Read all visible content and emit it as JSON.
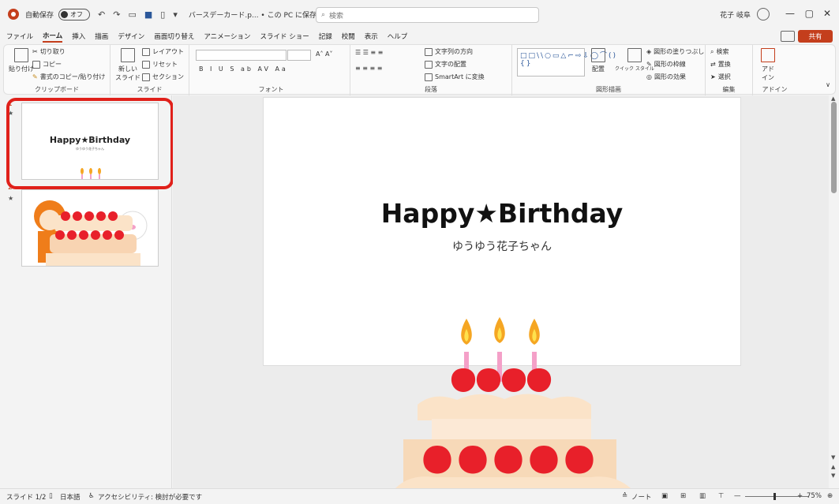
{
  "titlebar": {
    "autosave_label": "自動保存",
    "autosave_state": "オフ",
    "doc_title": "バースデーカード.p... • この PC に保存済み ∨",
    "search_placeholder": "検索",
    "user_name": "花子 岐阜",
    "minimize": "—",
    "restore": "▢",
    "close": "✕"
  },
  "tabs": [
    "ファイル",
    "ホーム",
    "挿入",
    "描画",
    "デザイン",
    "画面切り替え",
    "アニメーション",
    "スライド ショー",
    "記録",
    "校閲",
    "表示",
    "ヘルプ"
  ],
  "share_label": "共有",
  "ribbon": {
    "clipboard": {
      "paste": "貼り付け",
      "cut": "切り取り",
      "copy": "コピー",
      "format_painter": "書式のコピー/貼り付け",
      "label": "クリップボード"
    },
    "slides": {
      "new_slide": "新しい\nスライド",
      "layout": "レイアウト",
      "reset": "リセット",
      "section": "セクション",
      "label": "スライド"
    },
    "font": {
      "label": "フォント",
      "buttons": "B I U S ab AV Aa"
    },
    "paragraph": {
      "text_direction": "文字列の方向",
      "align_text": "文字の配置",
      "smartart": "SmartArt に変換",
      "label": "段落"
    },
    "drawing": {
      "arrange": "配置",
      "quick_styles": "クイック スタイル",
      "shape_fill": "図形の塗りつぶし",
      "shape_outline": "図形の枠線",
      "shape_effects": "図形の効果",
      "label": "図形描画"
    },
    "editing": {
      "find": "検索",
      "replace": "置換",
      "select": "選択",
      "label": "編集"
    },
    "addins": {
      "button": "アド\nイン",
      "label": "アドイン"
    }
  },
  "slides": [
    {
      "number": "1",
      "title": "Happy★Birthday",
      "subtitle": "ゆうゆう花子ちゃん"
    },
    {
      "number": "2"
    }
  ],
  "main_slide": {
    "title": "Happy★Birthday",
    "subtitle": "ゆうゆう花子ちゃん"
  },
  "statusbar": {
    "slide_info": "スライド 1/2",
    "language": "日本語",
    "accessibility": "アクセシビリティ: 検討が必要です",
    "notes": "ノート",
    "zoom": "75%"
  },
  "colors": {
    "accent": "#c43e1c",
    "highlight": "#e0201a",
    "strawberry": "#e8202a",
    "cream": "#fbe3c8",
    "candle": "#f4a0c8",
    "flame": "#f5a623"
  }
}
